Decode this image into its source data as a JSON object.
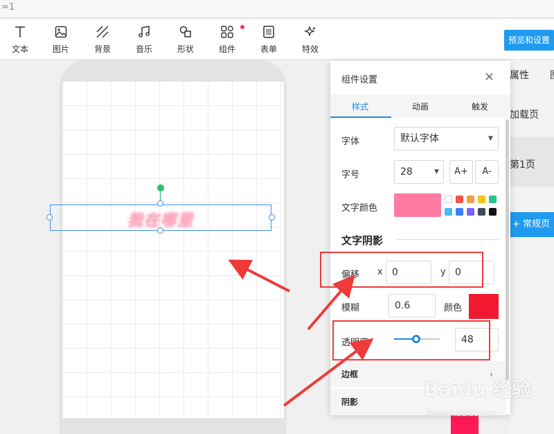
{
  "url_fragment": "=1",
  "toolbar": {
    "items": [
      {
        "label": "文本",
        "icon": "text-icon"
      },
      {
        "label": "图片",
        "icon": "image-icon"
      },
      {
        "label": "背景",
        "icon": "background-icon"
      },
      {
        "label": "音乐",
        "icon": "music-icon"
      },
      {
        "label": "形状",
        "icon": "shape-icon"
      },
      {
        "label": "组件",
        "icon": "component-icon"
      },
      {
        "label": "表单",
        "icon": "form-icon"
      },
      {
        "label": "特效",
        "icon": "effects-icon"
      }
    ],
    "preview_label": "预览和设置"
  },
  "canvas": {
    "text": "我在哪里"
  },
  "right_panel": {
    "tab_properties": "属性",
    "tab_pages": "图",
    "loading_page": "加载页",
    "page1": "第1页",
    "add_page": "+ 常规页"
  },
  "settings": {
    "title": "组件设置",
    "close": "×",
    "tabs": [
      "样式",
      "动画",
      "触发"
    ],
    "font_label": "字体",
    "font_value": "默认字体",
    "size_label": "字号",
    "size_value": "28",
    "increase": "A+",
    "decrease": "A-",
    "color_label": "文字颜色",
    "main_color": "#ff7ba3",
    "palette": [
      "#ffffff",
      "#f25546",
      "#f0a047",
      "#f5c518",
      "#2bc48b",
      "#4db6f5",
      "#3b82f6",
      "#7b61ff",
      "#3d4a5c",
      "#111111"
    ],
    "shadow_title": "文字阴影",
    "offset_label": "偏移",
    "x_label": "x",
    "x_value": "0",
    "y_label": "y",
    "y_value": "0",
    "blur_label": "模糊",
    "blur_value": "0.6",
    "shadow_color_label": "颜色",
    "shadow_color": "#f2182f",
    "opacity_label": "透明度",
    "opacity_value": "48",
    "opacity_fraction": 0.48,
    "border_label": "边框",
    "shadow_label": "阴影"
  },
  "watermark": {
    "brand": "Baidu 经验",
    "sub": "jingyan.baidu.com"
  }
}
